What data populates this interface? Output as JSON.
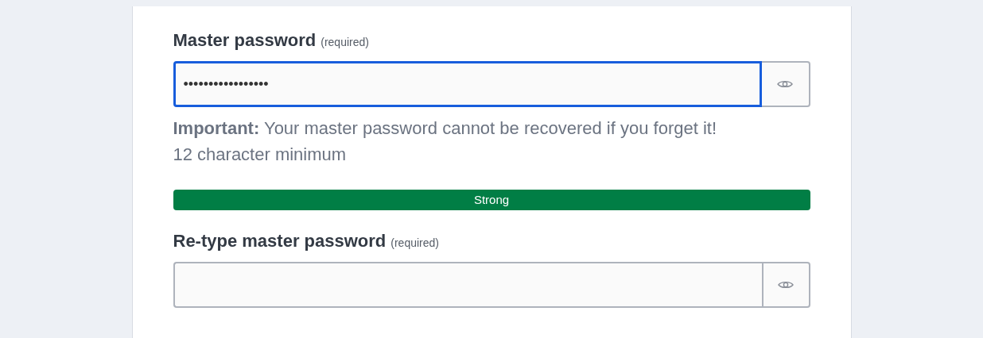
{
  "fields": [
    {
      "label": "Master password",
      "note": "(required)",
      "value": "•••••••••••••••••",
      "focused": true,
      "hint": "**Important:** Your master password cannot be recovered if you forget it! 12 character minimum",
      "strength": {
        "label": "Strong",
        "level": 1
      }
    },
    {
      "label": "Re-type master password",
      "note": "(required)",
      "focused": false
    }
  ]
}
